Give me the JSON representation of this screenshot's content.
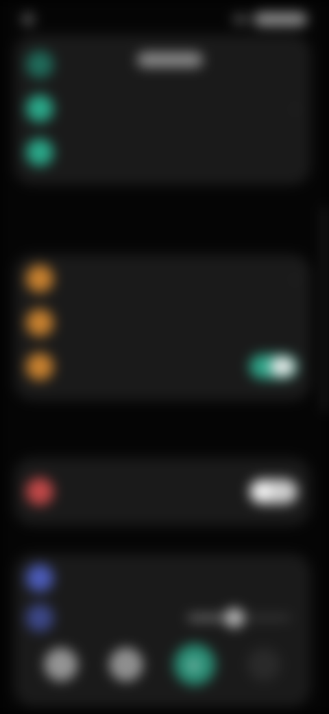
{
  "status_bar": {
    "time": "",
    "indicators": [
      "signal-icon",
      "wifi-icon",
      "battery-icon"
    ]
  },
  "sections": {
    "network": {
      "title": "",
      "rows": [
        {
          "label": "",
          "value": "",
          "icon": "sim-icon",
          "color": "#1f6b5a"
        },
        {
          "label": "",
          "value": "",
          "icon": "wifi-icon",
          "color": "#2aa889"
        },
        {
          "label": "",
          "value": "",
          "icon": "bluetooth-icon",
          "color": "#2aa889"
        }
      ]
    },
    "display": {
      "title": "",
      "rows": [
        {
          "label": "",
          "value": "",
          "icon": "brightness-icon",
          "color": "#c8812f"
        },
        {
          "label": "",
          "value": "",
          "icon": "theme-icon",
          "color": "#c8812f"
        },
        {
          "label": "",
          "value": "",
          "icon": "eye-comfort-icon",
          "color": "#c8812f",
          "toggle": true
        }
      ]
    },
    "security": {
      "title": "",
      "rows": [
        {
          "label": "",
          "value": "",
          "icon": "lock-icon",
          "color": "#c24848",
          "toggle": false
        }
      ]
    },
    "sound": {
      "title": "",
      "rows": [
        {
          "label": "",
          "value": "",
          "icon": "speaker-icon",
          "color": "#4b5bb8"
        },
        {
          "label": "",
          "value": "",
          "icon": "volume-icon",
          "color": "#4b5bb8",
          "slider_level": 0.45
        }
      ],
      "modes": [
        "sound-mode-icon",
        "vibrate-icon",
        "silent-icon",
        "dnd-icon"
      ],
      "active_mode": 2
    }
  },
  "colors": {
    "accent": "#2ea387",
    "network": "#2aa889",
    "display": "#c8812f",
    "security": "#c24848",
    "sound": "#4b5bb8"
  }
}
